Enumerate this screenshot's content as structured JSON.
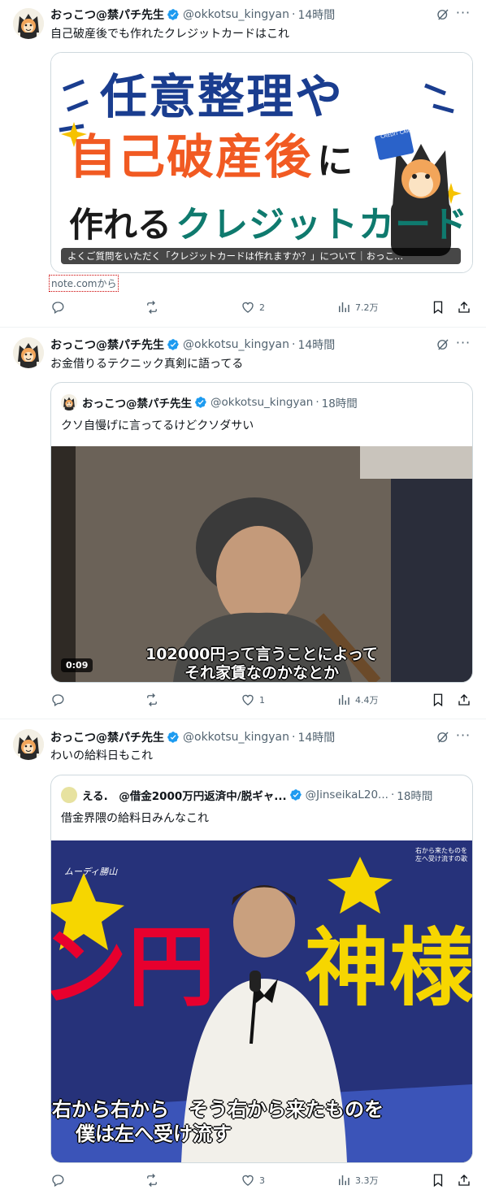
{
  "tweets": [
    {
      "author": "おっこつ@禁パチ先生",
      "handle": "@okkotsu_kingyan",
      "time": "14時間",
      "text": "自己破産後でも作れたクレジットカードはこれ",
      "card": {
        "headline_line1": "任意整理や",
        "headline_line2": "自己破産後",
        "headline_line2_suffix": "に",
        "headline_line3a": "作れる",
        "headline_line3b": "クレジットカード",
        "caption": "よくご質問をいただく「クレジットカードは作れますか？」について｜おっこ...",
        "source": "note.comから",
        "credit_card_text": "CREDIT CARD"
      },
      "stats": {
        "replies": "",
        "reposts": "",
        "likes": "2",
        "views": "7.2万"
      }
    },
    {
      "author": "おっこつ@禁パチ先生",
      "handle": "@okkotsu_kingyan",
      "time": "14時間",
      "text": "お金借りるテクニック真剣に語ってる",
      "quote": {
        "author": "おっこつ@禁パチ先生",
        "handle": "@okkotsu_kingyan",
        "time": "18時間",
        "text": "クソ自慢げに言ってるけどクソダサい",
        "video_duration": "0:09",
        "subtitle_line1": "102000円って言うことによって",
        "subtitle_line2": "それ家賃なのかなとか"
      },
      "stats": {
        "replies": "",
        "reposts": "",
        "likes": "1",
        "views": "4.4万"
      }
    },
    {
      "author": "おっこつ@禁パチ先生",
      "handle": "@okkotsu_kingyan",
      "time": "14時間",
      "text": "わいの給料日もこれ",
      "quote": {
        "author": "える.　@借金2000万円返済中/脱ギャ...",
        "handle": "@JinseikaL20...",
        "time": "18時間",
        "text": "借金界隈の給料日みんなこれ",
        "watermark": "ムーディ勝山",
        "corner_text": "右から来たものを左へ受け流すの歌",
        "big_text_left": "ン円",
        "big_text_right": "神様",
        "subtitle_line1": "右から右から　そう右から来たものを",
        "subtitle_line2": "僕は左へ受け流す"
      },
      "stats": {
        "replies": "",
        "reposts": "",
        "likes": "3",
        "views": "3.3万"
      }
    }
  ],
  "colors": {
    "text": "#0f1419",
    "secondary": "#536471",
    "verified": "#1d9bf0",
    "border": "#cfd9de"
  },
  "icons": [
    "verified-badge-icon",
    "grok-icon",
    "more-icon",
    "reply-icon",
    "repost-icon",
    "like-icon",
    "views-icon",
    "bookmark-icon",
    "share-icon"
  ]
}
